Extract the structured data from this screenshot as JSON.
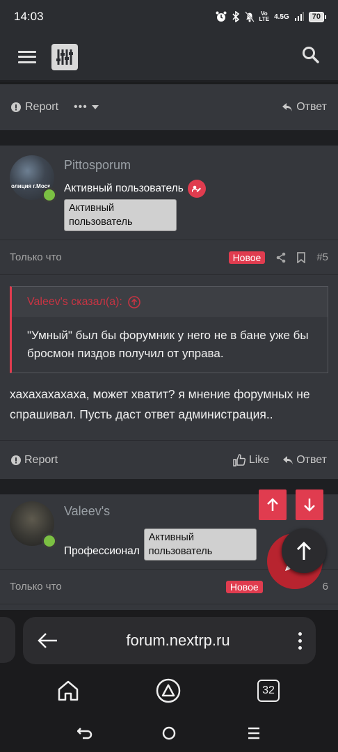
{
  "status_bar": {
    "time": "14:03",
    "network_top": "Vo",
    "network_bottom": "LTE",
    "signal": "4.5G",
    "battery": "70"
  },
  "header": {
    "menu_icon": "hamburger-icon",
    "logo_icon": "equalizer-icon",
    "search_icon": "search-icon"
  },
  "top_actions": {
    "report": "Report",
    "more": "•••",
    "reply": "Ответ"
  },
  "post1": {
    "username": "Pittosporum",
    "avatar_text": "олиция г.Моск",
    "user_title": "Активный пользователь",
    "tooltip": "Активный пользователь",
    "time": "Только что",
    "badge": "Новое",
    "number": "#5",
    "quote_author": "Valeev's сказал(а):",
    "quote_text": "\"Умный\" был бы форумник у него не в бане уже бы бросмон пиздов получил от управа.",
    "message": "хахахахахаха, может хватит? я мнение форумных не спрашивал. Пусть даст ответ администрация..",
    "report": "Report",
    "like": "Like",
    "reply": "Ответ"
  },
  "post2": {
    "username": "Valeev's",
    "user_title": "Профессионал",
    "tooltip": "Активный пользователь",
    "time": "Только что",
    "badge": "Новое",
    "number": "6"
  },
  "browser": {
    "url": "forum.nextrp.ru",
    "tabs_count": "32"
  },
  "colors": {
    "accent": "#e03c4f",
    "background": "#35373c",
    "online": "#7bc043"
  }
}
